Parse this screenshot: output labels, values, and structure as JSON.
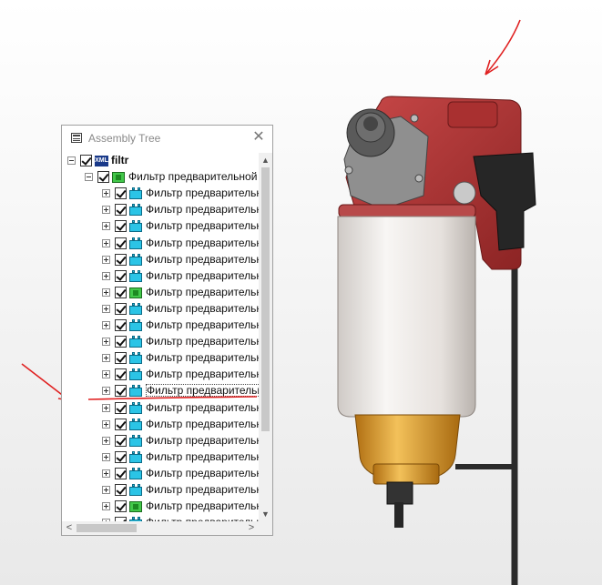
{
  "panel": {
    "title": "Assembly Tree",
    "close_symbol": "✕",
    "scroll_up": "▲",
    "scroll_down": "▼",
    "scroll_left": "<",
    "scroll_right": ">"
  },
  "tree": {
    "root": {
      "label": "filtr",
      "icon": "xml-icon",
      "checked": true,
      "expanded": true
    },
    "assembly": {
      "label": "Фильтр предварительной",
      "icon": "assembly-icon",
      "checked": true,
      "expanded": true
    },
    "children": [
      {
        "label": "Фильтр предварительн",
        "icon": "part-icon",
        "checked": true
      },
      {
        "label": "Фильтр предварительн",
        "icon": "part-icon",
        "checked": true
      },
      {
        "label": "Фильтр предварительн",
        "icon": "part-icon",
        "checked": true
      },
      {
        "label": "Фильтр предварительн",
        "icon": "part-icon",
        "checked": true
      },
      {
        "label": "Фильтр предварительн",
        "icon": "part-icon",
        "checked": true
      },
      {
        "label": "Фильтр предварительн",
        "icon": "part-icon",
        "checked": true
      },
      {
        "label": "Фильтр предварительн",
        "icon": "assembly-icon",
        "checked": true
      },
      {
        "label": "Фильтр предварительн",
        "icon": "part-icon",
        "checked": true
      },
      {
        "label": "Фильтр предварительн",
        "icon": "part-icon",
        "checked": true
      },
      {
        "label": "Фильтр предварительн",
        "icon": "part-icon",
        "checked": true
      },
      {
        "label": "Фильтр предварительн",
        "icon": "part-icon",
        "checked": true
      },
      {
        "label": "Фильтр предварительн",
        "icon": "part-icon",
        "checked": true
      },
      {
        "label": "Фильтр предварительн",
        "icon": "part-icon",
        "checked": true
      },
      {
        "label": "Фильтр предварительн",
        "icon": "part-icon",
        "checked": true
      },
      {
        "label": "Фильтр предварительн",
        "icon": "part-icon",
        "checked": true
      },
      {
        "label": "Фильтр предварительн",
        "icon": "part-icon",
        "checked": true
      },
      {
        "label": "Фильтр предварительн",
        "icon": "part-icon",
        "checked": true
      },
      {
        "label": "Фильтр предварительн",
        "icon": "part-icon",
        "checked": true
      },
      {
        "label": "Фильтр предварительн",
        "icon": "part-icon",
        "checked": true
      },
      {
        "label": "Фильтр предварительн",
        "icon": "assembly-icon",
        "checked": true
      },
      {
        "label": "Фильтр предварительн",
        "icon": "part-icon",
        "checked": true
      },
      {
        "label": "Фильтр предварительн",
        "icon": "part-icon",
        "checked": true
      }
    ]
  },
  "colors": {
    "filter_head": "#b63a3a",
    "filter_bowl": "#ece9e6",
    "brass_cup": "#d99a2b",
    "annotation": "#e02020"
  }
}
